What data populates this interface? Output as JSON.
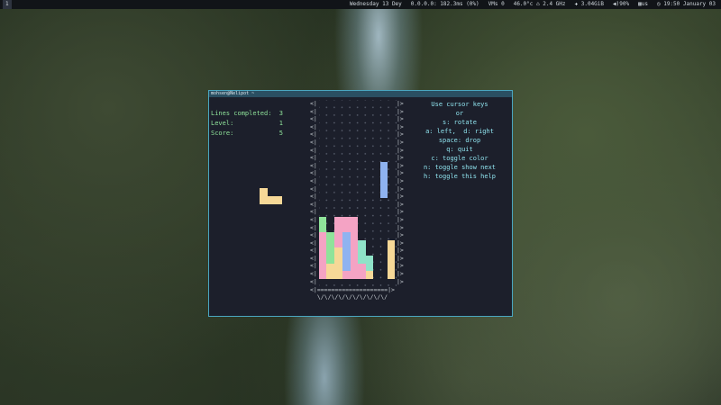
{
  "topbar": {
    "workspace": "1",
    "window_label": "",
    "date": "Wednesday 13 Dey",
    "network": "0.0.0.0: 182.3ms (0%)",
    "vms": "VMs 0",
    "cpu": "46.0°c ⌂ 2.4 GHz",
    "mem": "3.04GiB",
    "volume": "90%",
    "keyboard": "us",
    "clock": "19:50 January 03"
  },
  "window": {
    "title": "mohsen@Nelipot ~",
    "stats": [
      {
        "label": "Lines completed:",
        "value": "3"
      },
      {
        "label": "Level:",
        "value": "1"
      },
      {
        "label": "Score:",
        "value": "5"
      }
    ],
    "help_lines": [
      "Use cursor keys",
      "or",
      "s: rotate",
      "a: left,  d: right",
      "space: drop",
      "q: quit",
      "c: toggle color",
      "n: toggle show next",
      "h: toggle this help"
    ],
    "floor_line": "<|====================|>",
    "floor_zigzag": "\\/\\/\\/\\/\\/\\/\\/\\/\\/\\/"
  },
  "colors": {
    "green": "#8fe39a",
    "pink": "#f4a3c4",
    "blue": "#8fb3f0",
    "yellow": "#f6d897",
    "teal": "#8fe3c8",
    "frame": "#4aa6c0"
  }
}
